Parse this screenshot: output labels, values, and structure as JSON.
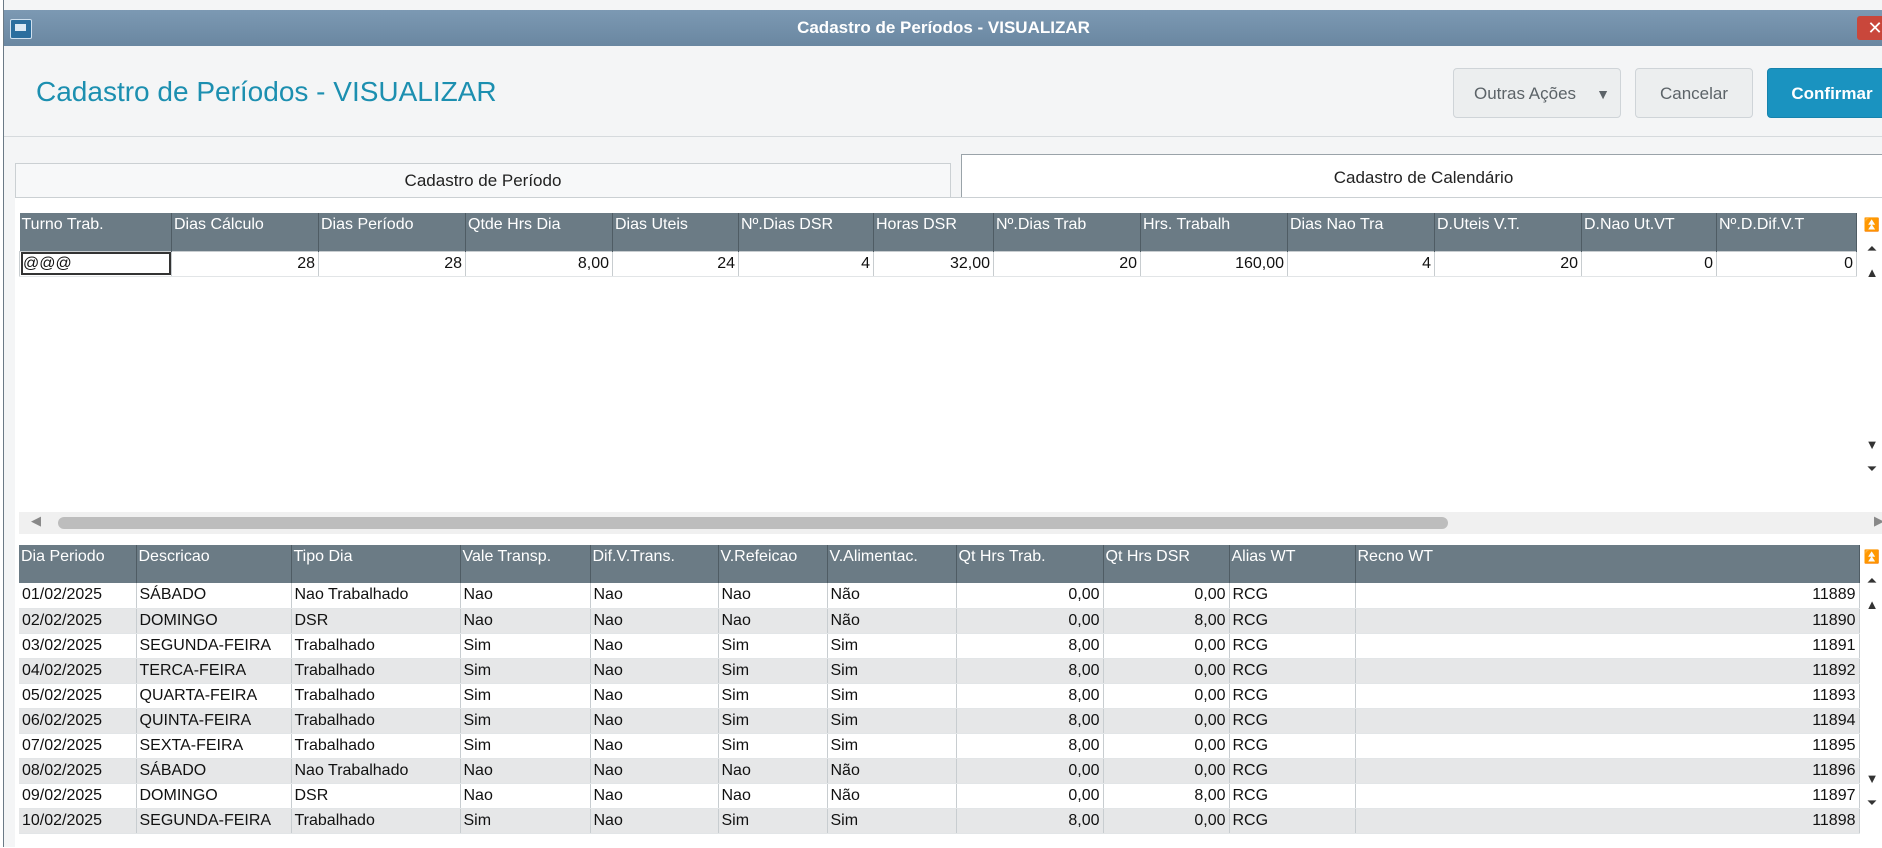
{
  "window": {
    "title": "Cadastro de Períodos - VISUALIZAR"
  },
  "header": {
    "title": "Cadastro de Períodos - VISUALIZAR",
    "buttons": {
      "outras": "Outras Ações",
      "cancelar": "Cancelar",
      "confirmar": "Confirmar"
    }
  },
  "tabs": [
    {
      "label": "Cadastro de Período",
      "active": false
    },
    {
      "label": "Cadastro de Calendário",
      "active": true
    }
  ],
  "top_grid": {
    "columns": [
      "Turno Trab.",
      "Dias Cálculo",
      "Dias Período",
      "Qtde Hrs Dia",
      "Dias Uteis",
      "Nº.Dias DSR",
      "Horas DSR",
      "Nº.Dias Trab",
      "Hrs. Trabalh",
      "Dias Nao Tra",
      "D.Uteis V.T.",
      "D.Nao Ut.VT",
      "Nº.D.Dif.V.T"
    ],
    "rows": [
      [
        "@@@",
        "28",
        "28",
        "8,00",
        "24",
        "4",
        "32,00",
        "20",
        "160,00",
        "4",
        "20",
        "0",
        "0"
      ]
    ]
  },
  "bottom_grid": {
    "columns": [
      "Dia Periodo",
      "Descricao",
      "Tipo Dia",
      "Vale Transp.",
      "Dif.V.Trans.",
      "V.Refeicao",
      "V.Alimentac.",
      "Qt Hrs Trab.",
      "Qt Hrs DSR",
      "Alias WT",
      "Recno WT"
    ],
    "rows": [
      [
        "01/02/2025",
        "SÁBADO",
        "Nao Trabalhado",
        "Nao",
        "Nao",
        "Nao",
        "Não",
        "0,00",
        "0,00",
        "RCG",
        "11889"
      ],
      [
        "02/02/2025",
        "DOMINGO",
        "DSR",
        "Nao",
        "Nao",
        "Nao",
        "Não",
        "0,00",
        "8,00",
        "RCG",
        "11890"
      ],
      [
        "03/02/2025",
        "SEGUNDA-FEIRA",
        "Trabalhado",
        "Sim",
        "Nao",
        "Sim",
        "Sim",
        "8,00",
        "0,00",
        "RCG",
        "11891"
      ],
      [
        "04/02/2025",
        "TERCA-FEIRA",
        "Trabalhado",
        "Sim",
        "Nao",
        "Sim",
        "Sim",
        "8,00",
        "0,00",
        "RCG",
        "11892"
      ],
      [
        "05/02/2025",
        "QUARTA-FEIRA",
        "Trabalhado",
        "Sim",
        "Nao",
        "Sim",
        "Sim",
        "8,00",
        "0,00",
        "RCG",
        "11893"
      ],
      [
        "06/02/2025",
        "QUINTA-FEIRA",
        "Trabalhado",
        "Sim",
        "Nao",
        "Sim",
        "Sim",
        "8,00",
        "0,00",
        "RCG",
        "11894"
      ],
      [
        "07/02/2025",
        "SEXTA-FEIRA",
        "Trabalhado",
        "Sim",
        "Nao",
        "Sim",
        "Sim",
        "8,00",
        "0,00",
        "RCG",
        "11895"
      ],
      [
        "08/02/2025",
        "SÁBADO",
        "Nao Trabalhado",
        "Nao",
        "Nao",
        "Nao",
        "Não",
        "0,00",
        "0,00",
        "RCG",
        "11896"
      ],
      [
        "09/02/2025",
        "DOMINGO",
        "DSR",
        "Nao",
        "Nao",
        "Nao",
        "Não",
        "0,00",
        "8,00",
        "RCG",
        "11897"
      ],
      [
        "10/02/2025",
        "SEGUNDA-FEIRA",
        "Trabalhado",
        "Sim",
        "Nao",
        "Sim",
        "Sim",
        "8,00",
        "0,00",
        "RCG",
        "11898"
      ]
    ]
  },
  "colors": {
    "accent": "#1a93c0",
    "title_blue": "#1c8fb0",
    "header_gray": "#6b7b85",
    "titlebar": "#7c99b3"
  }
}
